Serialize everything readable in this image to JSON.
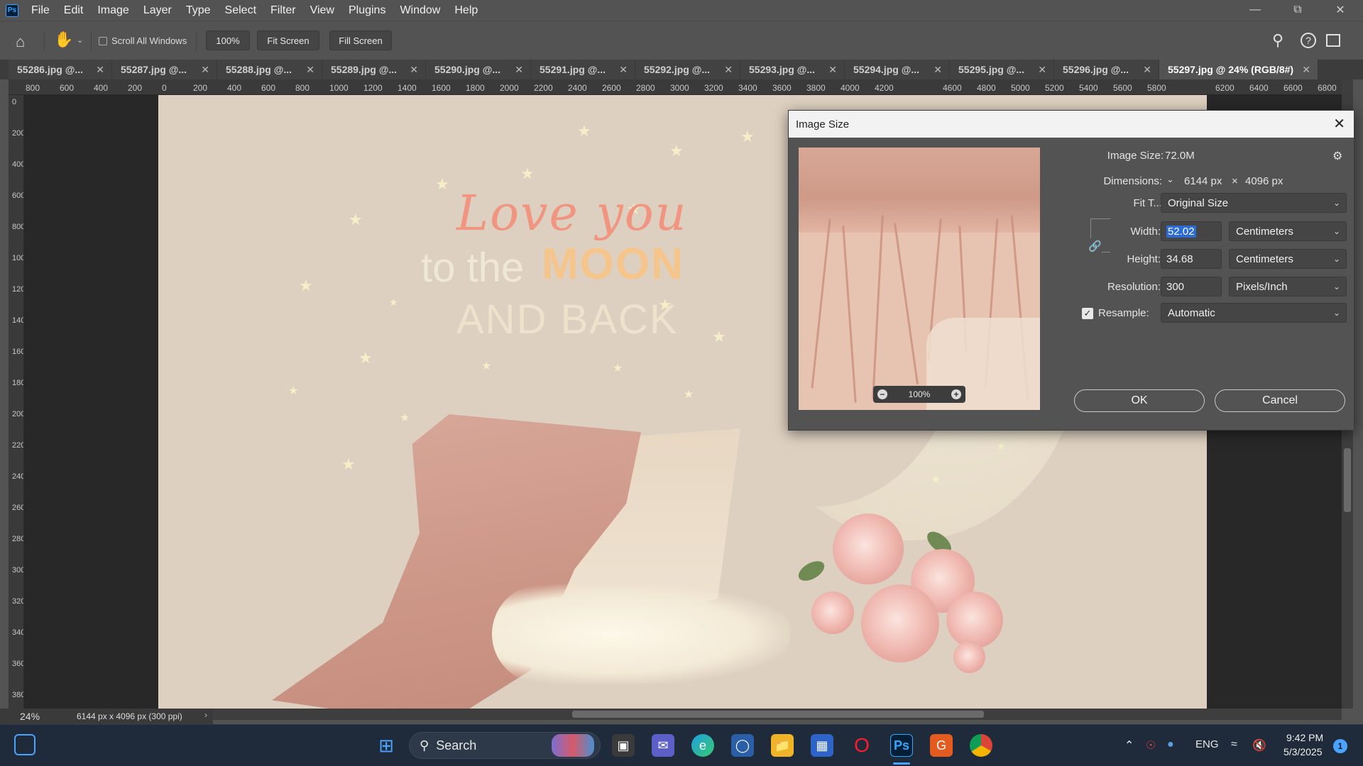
{
  "menubar": {
    "logo": "Ps",
    "items": [
      "File",
      "Edit",
      "Image",
      "Layer",
      "Type",
      "Select",
      "Filter",
      "View",
      "Plugins",
      "Window",
      "Help"
    ]
  },
  "options": {
    "scroll_all_windows": "Scroll All Windows",
    "zoom_value": "100%",
    "fit_screen": "Fit Screen",
    "fill_screen": "Fill Screen"
  },
  "tabs": [
    "55286.jpg @...",
    "55287.jpg @...",
    "55288.jpg @...",
    "55289.jpg @...",
    "55290.jpg @...",
    "55291.jpg @...",
    "55292.jpg @...",
    "55293.jpg @...",
    "55294.jpg @...",
    "55295.jpg @...",
    "55296.jpg @...",
    "55297.jpg @ 24% (RGB/8#)"
  ],
  "ruler": {
    "h_ticks": [
      "800",
      "600",
      "400",
      "200",
      "0",
      "200",
      "400",
      "600",
      "800",
      "1000",
      "1200",
      "1400",
      "1600",
      "1800",
      "2000",
      "2200",
      "2400",
      "2600",
      "2800",
      "3000",
      "3200",
      "3400",
      "3600",
      "3800",
      "4000",
      "4200",
      "4600",
      "4800",
      "5000",
      "5200",
      "5400",
      "5600",
      "5800",
      "6200",
      "6400",
      "6600",
      "6800"
    ],
    "v_ticks": [
      "0",
      "200",
      "400",
      "600",
      "800",
      "1000",
      "1200",
      "1400",
      "1600",
      "1800",
      "2000",
      "2200",
      "2400",
      "2600",
      "2800",
      "3000",
      "3200",
      "3400",
      "3600",
      "3800"
    ]
  },
  "artwork": {
    "line1": "Love you",
    "line2a": "to the",
    "line2b": "MOON",
    "line3": "AND BACK"
  },
  "status": {
    "zoom": "24%",
    "doc_info": "6144 px x 4096 px (300 ppi)"
  },
  "dialog": {
    "title": "Image Size",
    "image_size_label": "Image Size:",
    "image_size_value": "72.0M",
    "dimensions_label": "Dimensions:",
    "dim_width": "6144 px",
    "dim_x": "×",
    "dim_height": "4096 px",
    "fit_label": "Fit T...",
    "fit_value": "Original Size",
    "width_label": "Width:",
    "width_value": "52.02",
    "width_unit": "Centimeters",
    "height_label": "Height:",
    "height_value": "34.68",
    "height_unit": "Centimeters",
    "resolution_label": "Resolution:",
    "resolution_value": "300",
    "resolution_unit": "Pixels/Inch",
    "resample_label": "Resample:",
    "resample_value": "Automatic",
    "preview_zoom": "100%",
    "ok": "OK",
    "cancel": "Cancel"
  },
  "taskbar": {
    "search": "Search",
    "lang": "ENG",
    "time": "9:42 PM",
    "date": "5/3/2025",
    "notifications": "1"
  }
}
